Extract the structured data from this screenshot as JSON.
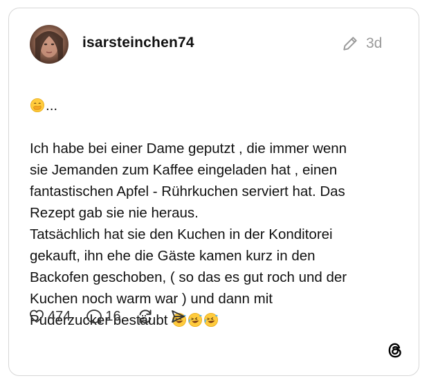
{
  "post": {
    "username": "isarsteinchen74",
    "time": "3d",
    "lead_emoji": "🤭",
    "lead_text": "...",
    "text": "Ich habe bei einer Dame geputzt , die immer wenn\nsie Jemanden zum Kaffee eingeladen hat , einen\nfantastischen  Apfel -  Rührkuchen serviert hat. Das\nRezept gab sie nie heraus.\nTatsächlich hat sie den Kuchen in der Konditorei\ngekauft, ihn ehe die Gäste kamen kurz in den\nBackofen geschoben, ( so das es gut roch und der\nKuchen noch warm war ) und dann mit\nPuderzucker bestäubt ",
    "trailing_emojis": "🤣🤣🤣"
  },
  "actions": {
    "likes": "474",
    "replies": "16"
  },
  "icons": {
    "edit": "pencil-icon",
    "like": "heart-icon",
    "reply": "speech-bubble-icon",
    "repost": "repost-icon",
    "share": "send-icon",
    "brand": "threads-logo-icon"
  }
}
